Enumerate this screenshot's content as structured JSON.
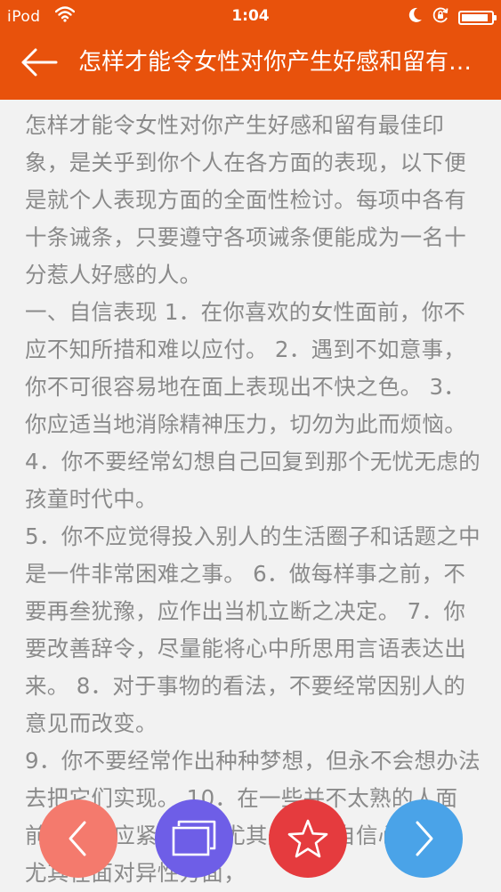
{
  "status_bar": {
    "carrier": "iPod",
    "time": "1:04",
    "battery_level": 0.92,
    "icons": [
      "wifi-icon",
      "moon-icon",
      "rotation-lock-icon",
      "battery-icon"
    ]
  },
  "nav": {
    "back_icon": "arrow-left-icon",
    "title": "怎样才能令女性对你产生好感和留有最佳印象"
  },
  "article": {
    "paragraphs": [
      "怎样才能令女性对你产生好感和留有最佳印象，是关乎到你个人在各方面的表现，以下便是就个人表现方面的全面性检讨。每项中各有十条诫条，只要遵守各项诫条便能成为一名十分惹人好感的人。",
      "一、自信表现 1．在你喜欢的女性面前，你不应不知所措和难以应付。 2．遇到不如意事，你不可很容易地在面上表现出不快之色。 3．你应适当地消除精神压力，切勿为此而烦恼。 4．你不要经常幻想自己回复到那个无忧无虑的孩童时代中。",
      "5．你不应觉得投入别人的生活圈子和话题之中是一件非常困难之事。 6．做每样事之前，不要再叁犹豫，应作出当机立断之决定。 7．你要改善辞令，尽量能将心中所思用言语表达出来。 8．对于事物的看法，不要经常因别人的意见而改变。",
      "9．你不要经常作出种种梦想，但永不会想办法去把它们实现。 10．在一些并不太熟的人面前，你不应紧张的，尤其是缺乏自信心的人。尤其在面对异性方面，"
    ]
  },
  "bottom_bar": {
    "colors": {
      "prev": "#f47a6d",
      "pages": "#6e5ee7",
      "favorite": "#e53b3e",
      "next": "#4aa3e8"
    },
    "icons": [
      "chevron-left-icon",
      "pages-icon",
      "star-icon",
      "chevron-right-icon"
    ]
  },
  "theme": {
    "header_color": "#e8520c",
    "text_color": "#8a8a8a",
    "background": "#f2f2f2"
  }
}
